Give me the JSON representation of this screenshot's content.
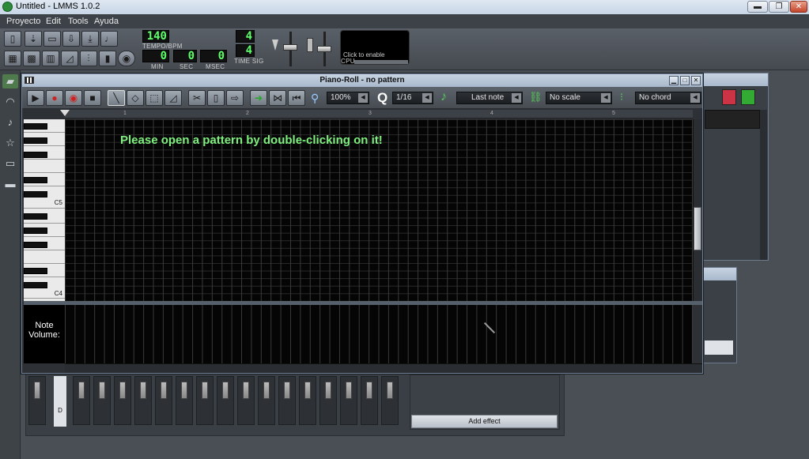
{
  "window": {
    "title": "Untitled - LMMS 1.0.2",
    "min": "▬",
    "max": "❐",
    "close": "✕"
  },
  "menu": [
    "Proyecto",
    "Edit",
    "Tools",
    "Ayuda"
  ],
  "toolbar": {
    "tempo": "140",
    "tempo_label": "TEMPO/BPM",
    "min": "0",
    "sec": "0",
    "msec": "0",
    "min_label": "MIN",
    "sec_label": "SEC",
    "msec_label": "MSEC",
    "timesig_num": "4",
    "timesig_den": "4",
    "timesig_label": "TIME SIG",
    "cpu_text": "Click to enable",
    "cpu_label": "CPU"
  },
  "piano_roll": {
    "title": "Piano-Roll - no pattern",
    "zoom": "100%",
    "quantize_label": "Q",
    "quantize": "1/16",
    "note_length": "Last note",
    "scale": "No scale",
    "chord": "No chord",
    "ruler": [
      "1",
      "2",
      "3",
      "4",
      "5"
    ],
    "message": "Please open a pattern by double-clicking on it!",
    "key_c5": "C5",
    "key_c4": "C4",
    "volume_label_1": "Note",
    "volume_label_2": "Volume:"
  },
  "mixer": {
    "add_effect": "Add effect",
    "channel_label": "D"
  }
}
